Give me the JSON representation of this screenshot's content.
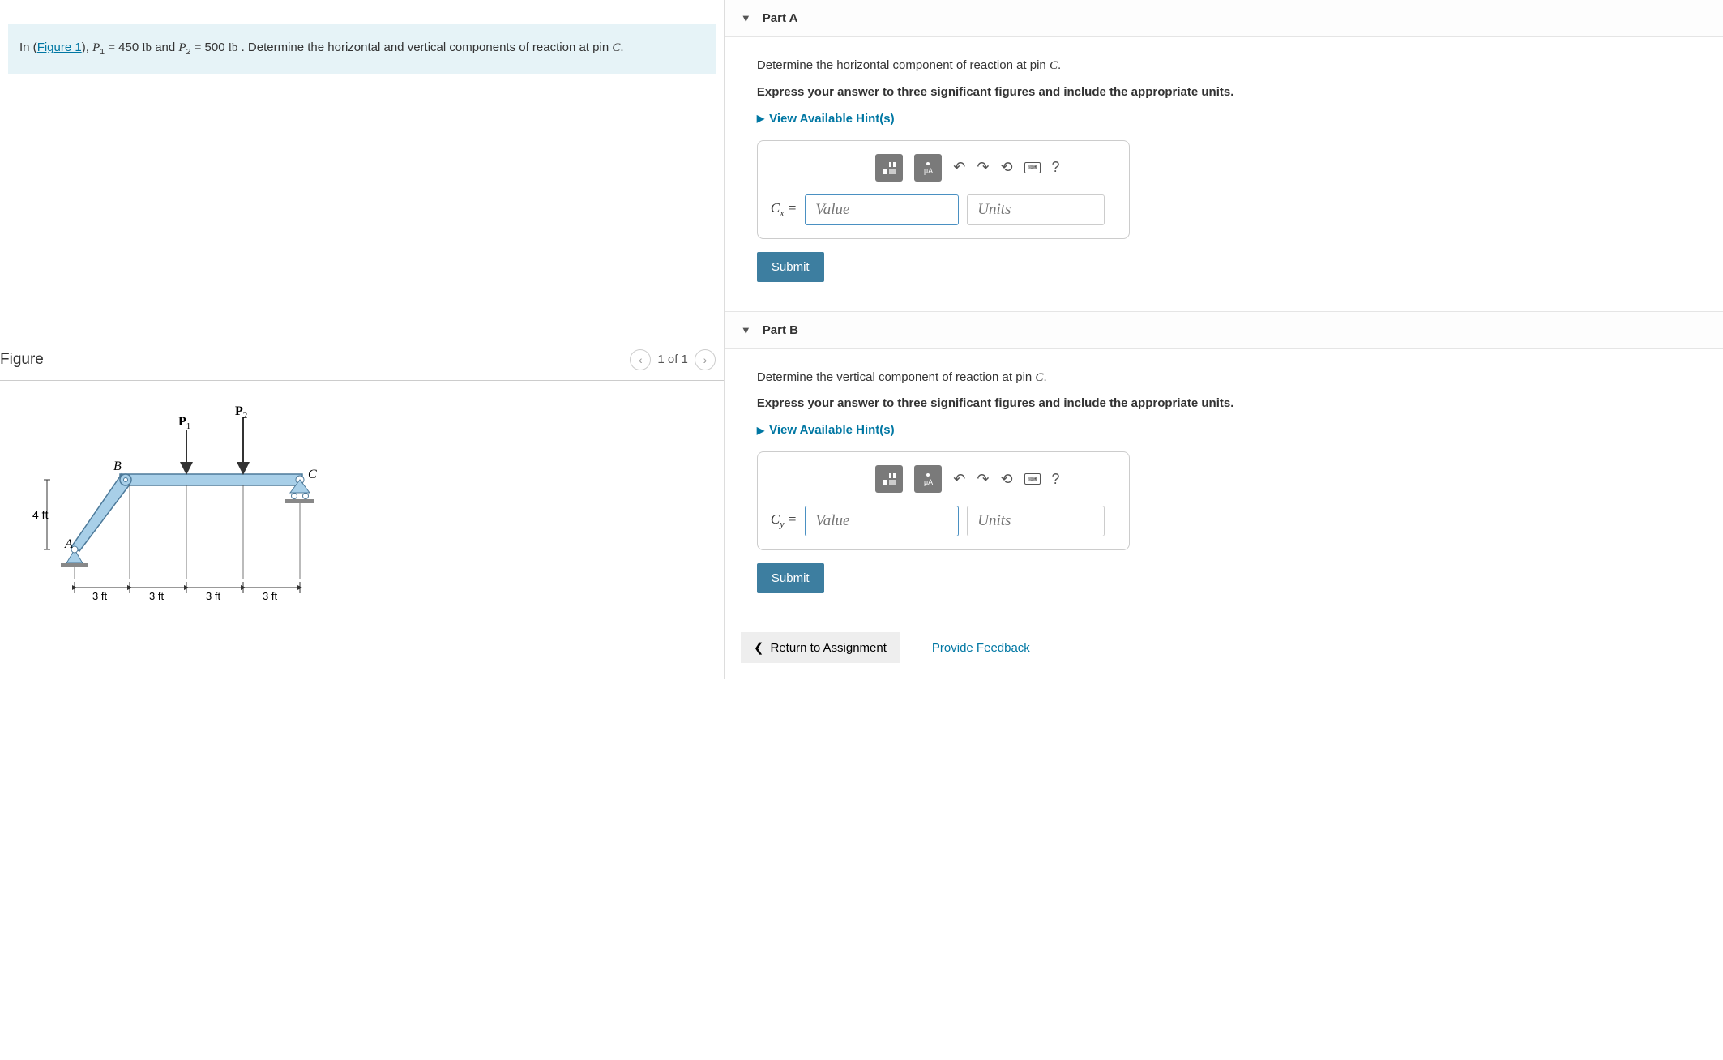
{
  "problem": {
    "pre": "In (",
    "figLink": "Figure 1",
    "post1": "), ",
    "p1sym": "P",
    "p1sub": "1",
    "p1val": " = 450 ",
    "p1unit": "lb",
    "and": " and ",
    "p2sym": "P",
    "p2sub": "2",
    "p2val": " = 500 ",
    "p2unit": "lb",
    "post2": " . Determine the horizontal and vertical components of reaction at pin ",
    "pinC": "C",
    "period": "."
  },
  "figure": {
    "title": "Figure",
    "counter": "1 of 1",
    "labels": {
      "P1": "P",
      "P1sub": "1",
      "P2": "P",
      "P2sub": "2",
      "A": "A",
      "B": "B",
      "C": "C",
      "h": "4 ft",
      "d": "3 ft"
    }
  },
  "partA": {
    "header": "Part A",
    "question_pre": "Determine the horizontal component of reaction at pin ",
    "question_var": "C",
    "question_post": ".",
    "instruction": "Express your answer to three significant figures and include the appropriate units.",
    "hints": "View Available Hint(s)",
    "label_var": "C",
    "label_sub": "x",
    "label_eq": " = ",
    "value_ph": "Value",
    "units_ph": "Units",
    "submit": "Submit"
  },
  "partB": {
    "header": "Part B",
    "question_pre": "Determine the vertical component of reaction at pin ",
    "question_var": "C",
    "question_post": ".",
    "instruction": "Express your answer to three significant figures and include the appropriate units.",
    "hints": "View Available Hint(s)",
    "label_var": "C",
    "label_sub": "y",
    "label_eq": " = ",
    "value_ph": "Value",
    "units_ph": "Units",
    "submit": "Submit"
  },
  "footer": {
    "return": "Return to Assignment",
    "feedback": "Provide Feedback"
  },
  "toolbar": {
    "help": "?"
  }
}
